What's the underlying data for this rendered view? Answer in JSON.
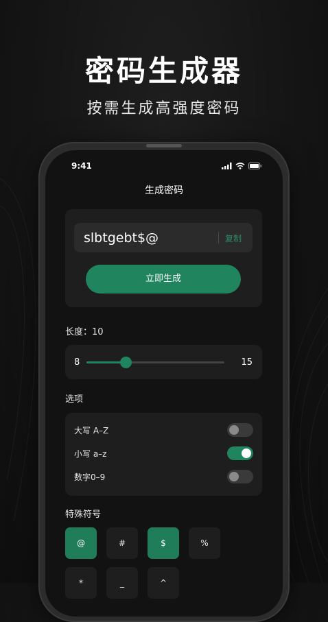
{
  "hero": {
    "title": "密码生成器",
    "subtitle": "按需生成高强度密码"
  },
  "status_bar": {
    "time": "9:41",
    "icons": [
      "signal-icon",
      "wifi-icon",
      "battery-icon"
    ]
  },
  "nav": {
    "title": "生成密码"
  },
  "generator": {
    "password": "slbtgebt$@",
    "copy_label": "复制",
    "generate_label": "立即生成"
  },
  "length": {
    "label": "长度：10",
    "min": "8",
    "max": "15",
    "value": 10
  },
  "options": {
    "label": "选项",
    "items": [
      {
        "label": "大写 A–Z",
        "enabled": false
      },
      {
        "label": "小写 a–z",
        "enabled": true
      },
      {
        "label": "数字0–9",
        "enabled": false
      }
    ]
  },
  "special": {
    "label": "特殊符号",
    "symbols": [
      {
        "char": "@",
        "selected": true
      },
      {
        "char": "#",
        "selected": false
      },
      {
        "char": "$",
        "selected": true
      },
      {
        "char": "%",
        "selected": false
      },
      {
        "char": "*",
        "selected": false
      },
      {
        "char": "_",
        "selected": false
      },
      {
        "char": "^",
        "selected": false
      }
    ]
  },
  "colors": {
    "accent": "#20845e",
    "background": "#121212",
    "card": "#1e1e1e"
  }
}
